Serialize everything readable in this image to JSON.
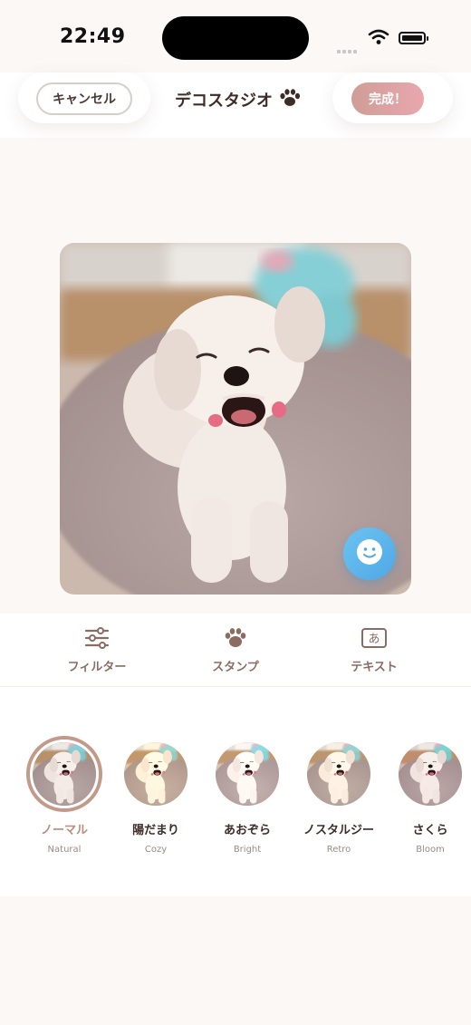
{
  "status_bar": {
    "time": "22:49"
  },
  "header": {
    "cancel_label": "キャンセル",
    "title": "デコスタジオ",
    "done_label": "完成！"
  },
  "tools": [
    {
      "label": "フィルター",
      "icon": "sliders-icon"
    },
    {
      "label": "スタンプ",
      "icon": "paw-icon"
    },
    {
      "label": "テキスト",
      "icon": "text-box-icon"
    }
  ],
  "filters": [
    {
      "name": "ノーマル",
      "sub": "Natural",
      "selected": true
    },
    {
      "name": "陽だまり",
      "sub": "Cozy",
      "selected": false
    },
    {
      "name": "あおぞら",
      "sub": "Bright",
      "selected": false
    },
    {
      "name": "ノスタルジー",
      "sub": "Retro",
      "selected": false
    },
    {
      "name": "さくら",
      "sub": "Bloom",
      "selected": false
    }
  ],
  "colors": {
    "accent": "#c39a89",
    "done_gradient_start": "#cf9d97",
    "done_gradient_end": "#e9a7ae",
    "sticker_button": "#5bb5ec"
  }
}
